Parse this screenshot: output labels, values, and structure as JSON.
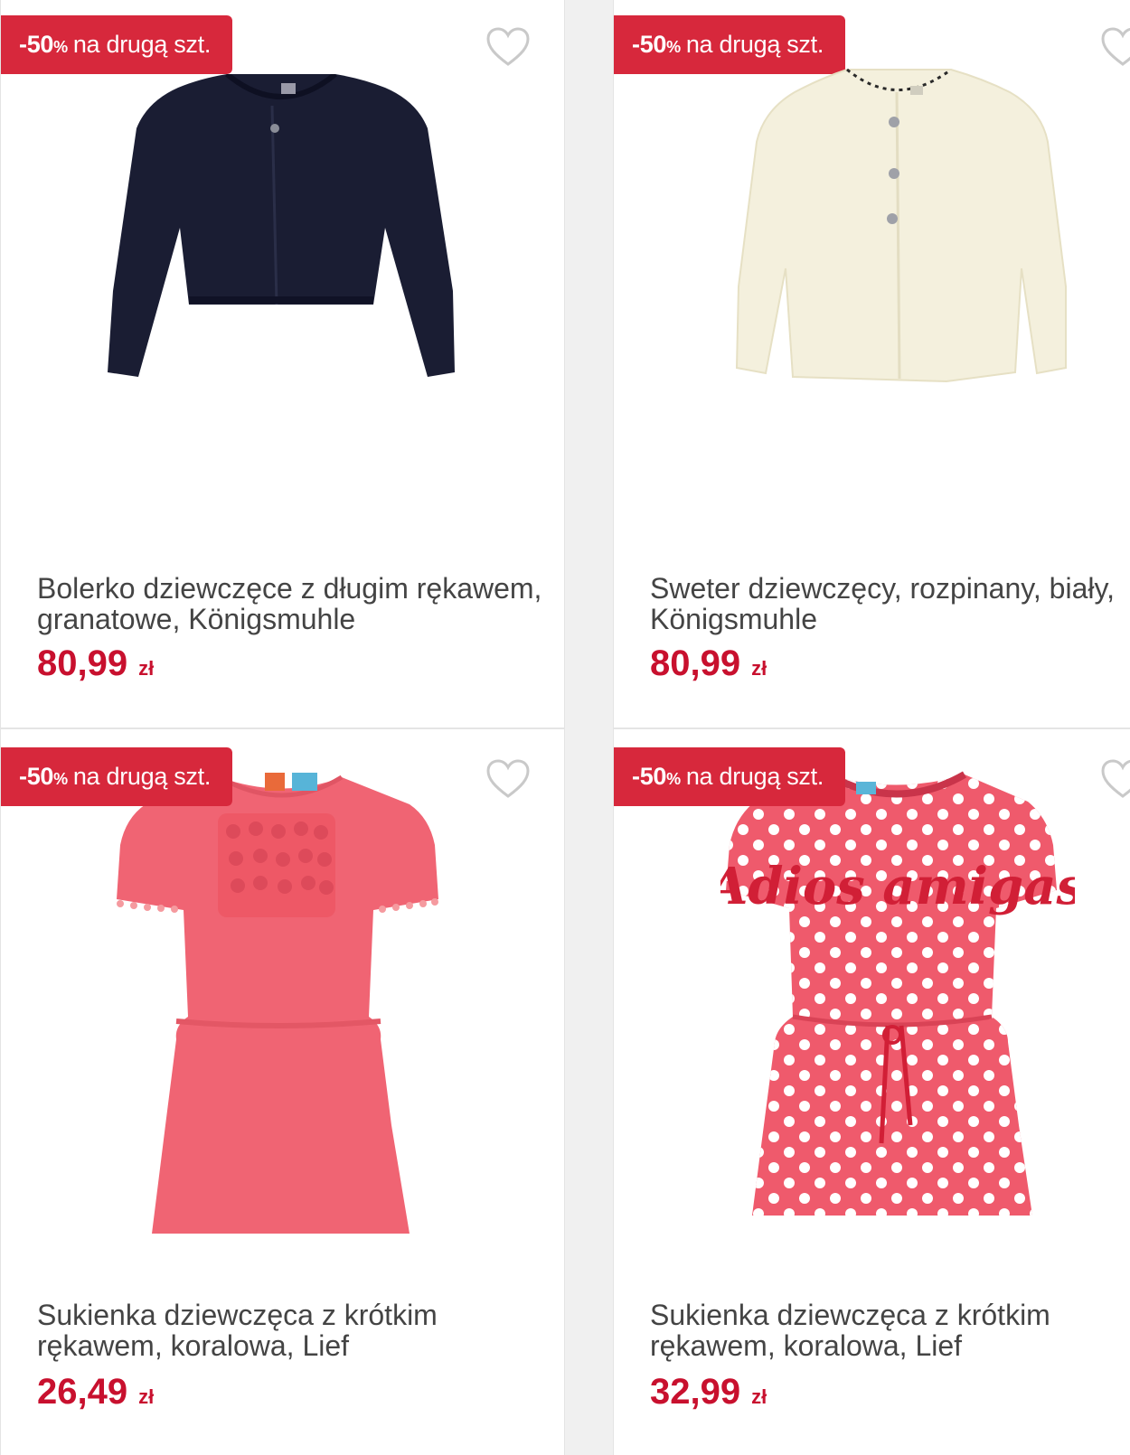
{
  "products": [
    {
      "badge_pct": "-50",
      "badge_pct_sign": "%",
      "badge_text": "na drugą szt.",
      "title": "Bolerko dziewczęce z długim rękawem, granatowe, Königsmuhle",
      "price": "80,99",
      "currency": "zł",
      "image": "navy-bolero-cardigan",
      "heart_icon": "heart-outline-icon"
    },
    {
      "badge_pct": "-50",
      "badge_pct_sign": "%",
      "badge_text": "na drugą szt.",
      "title": "Sweter dziewczęcy, rozpinany, biały, Königsmuhle",
      "price": "80,99",
      "currency": "zł",
      "image": "white-fluffy-cardigan",
      "heart_icon": "heart-outline-icon"
    },
    {
      "badge_pct": "-50",
      "badge_pct_sign": "%",
      "badge_text": "na drugą szt.",
      "title": "Sukienka dziewczęca z krótkim rękawem, koralowa, Lief",
      "price": "26,49",
      "currency": "zł",
      "image": "coral-ruffle-dress",
      "heart_icon": "heart-outline-icon"
    },
    {
      "badge_pct": "-50",
      "badge_pct_sign": "%",
      "badge_text": "na drugą szt.",
      "title": "Sukienka dziewczęca z krótkim rękawem, koralowa, Lief",
      "price": "32,99",
      "currency": "zł",
      "image": "coral-polka-dot-dress",
      "print_text": "Adios amigas",
      "heart_icon": "heart-outline-icon"
    }
  ],
  "colors": {
    "badge": "#d7283c",
    "price": "#c8102e",
    "title": "#444444",
    "heart": "#c9c9c9"
  }
}
